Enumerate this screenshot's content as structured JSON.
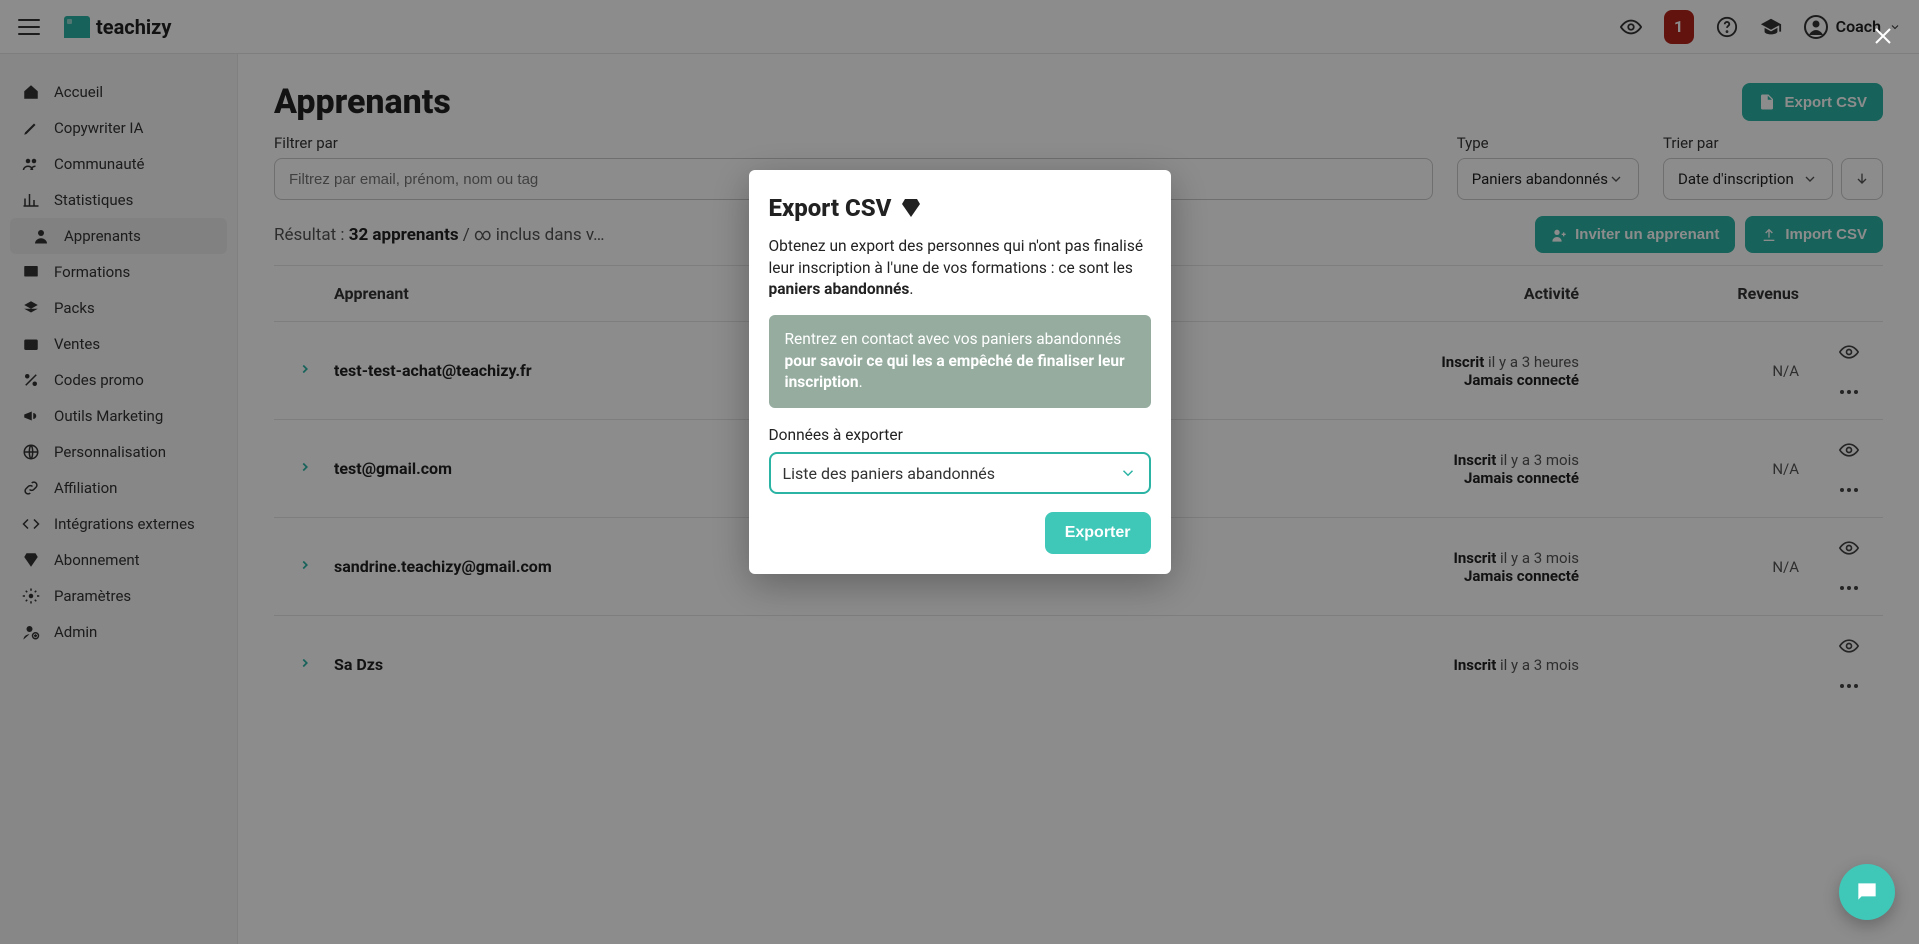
{
  "brand": {
    "name": "teachizy"
  },
  "topbar": {
    "notification_count": "1",
    "user_name": "Coach"
  },
  "sidebar": {
    "items": [
      {
        "label": "Accueil",
        "icon": "home"
      },
      {
        "label": "Copywriter IA",
        "icon": "pen"
      },
      {
        "label": "Communauté",
        "icon": "users"
      },
      {
        "label": "Statistiques",
        "icon": "chart"
      },
      {
        "label": "Apprenants",
        "icon": "user",
        "active": true
      },
      {
        "label": "Formations",
        "icon": "board"
      },
      {
        "label": "Packs",
        "icon": "layers"
      },
      {
        "label": "Ventes",
        "icon": "wallet"
      },
      {
        "label": "Codes promo",
        "icon": "percent"
      },
      {
        "label": "Outils Marketing",
        "icon": "megaphone"
      },
      {
        "label": "Personnalisation",
        "icon": "globe"
      },
      {
        "label": "Affiliation",
        "icon": "link"
      },
      {
        "label": "Intégrations externes",
        "icon": "code"
      },
      {
        "label": "Abonnement",
        "icon": "gem"
      },
      {
        "label": "Paramètres",
        "icon": "gear"
      },
      {
        "label": "Admin",
        "icon": "admin"
      }
    ]
  },
  "page": {
    "title": "Apprenants",
    "export_csv_btn": "Export CSV",
    "filters": {
      "filter_label": "Filtrer par",
      "filter_placeholder": "Filtrez par email, prénom, nom ou tag",
      "type_label": "Type",
      "type_value": "Paniers abandonnés",
      "sort_label": "Trier par",
      "sort_value": "Date d'inscription"
    },
    "result": {
      "prefix": "Résultat : ",
      "count_text": "32 apprenants",
      "suffix": " / ∞ inclus dans v…"
    },
    "invite_btn": "Inviter un apprenant",
    "import_btn": "Import CSV",
    "columns": {
      "apprenant": "Apprenant",
      "activite": "Activité",
      "revenus": "Revenus"
    },
    "rows": [
      {
        "name": "test-test-achat@teachizy.fr",
        "activity_label": "Inscrit",
        "activity_when": " il y a 3 heures",
        "connected": "Jamais connecté",
        "revenue": "N/A"
      },
      {
        "name": "test@gmail.com",
        "activity_label": "Inscrit",
        "activity_when": " il y a 3 mois",
        "connected": "Jamais connecté",
        "revenue": "N/A"
      },
      {
        "name": "sandrine.teachizy@gmail.com",
        "activity_label": "Inscrit",
        "activity_when": " il y a 3 mois",
        "connected": "Jamais connecté",
        "revenue": "N/A"
      },
      {
        "name": "Sa Dzs",
        "activity_label": "Inscrit",
        "activity_when": " il y a 3 mois",
        "connected": "",
        "revenue": ""
      }
    ]
  },
  "modal": {
    "title": "Export CSV",
    "text_before": "Obtenez un export des personnes qui n'ont pas finalisé leur inscription à l'une de vos formations : ce sont les ",
    "text_strong": "paniers abandonnés",
    "text_after": ".",
    "tip_before": "Rentrez en contact avec vos paniers abandonnés ",
    "tip_strong": "pour savoir ce qui les a empêché de finaliser leur inscription",
    "tip_after": ".",
    "select_label": "Données à exporter",
    "select_value": "Liste des paniers abandonnés",
    "export_btn": "Exporter"
  }
}
